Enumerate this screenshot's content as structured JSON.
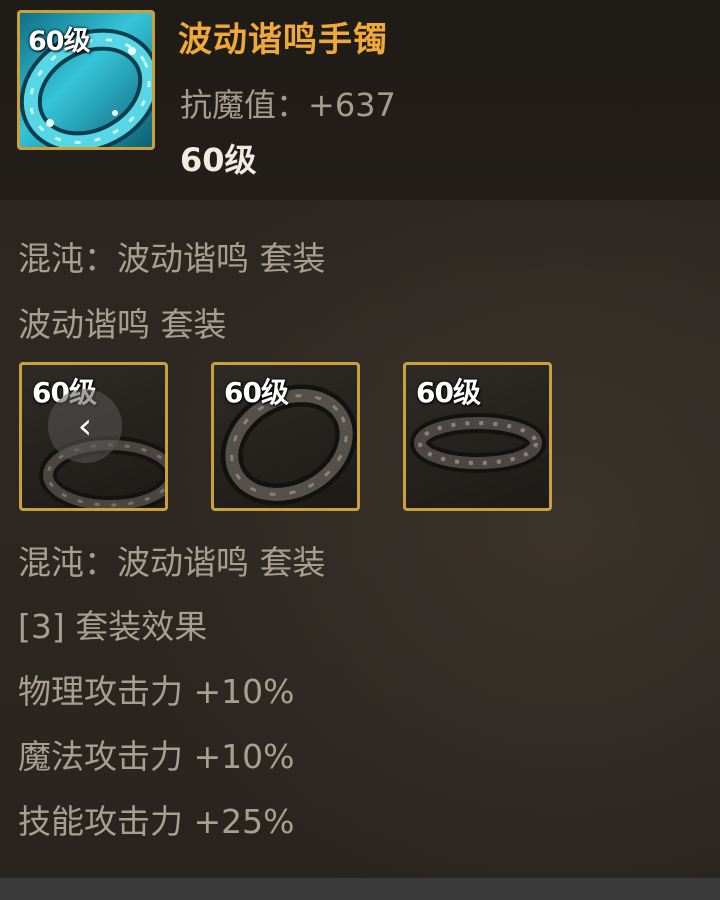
{
  "item": {
    "icon": "bracelet-icon",
    "level_tag": "60级",
    "name": "波动谐鸣手镯",
    "stat": "抗魔值：+637",
    "level": "60级"
  },
  "set": {
    "set_line_1": "混沌：波动谐鸣 套装",
    "set_line_2": "波动谐鸣 套装",
    "pieces": [
      {
        "level_tag": "60级",
        "icon": "ring-icon"
      },
      {
        "level_tag": "60级",
        "icon": "bracelet-icon"
      },
      {
        "level_tag": "60级",
        "icon": "necklace-icon"
      }
    ],
    "set_line_3": "混沌：波动谐鸣 套装",
    "effect_header": "[3] 套装效果",
    "effects": [
      "物理攻击力 +10%",
      "魔法攻击力 +10%",
      "技能攻击力 +25%"
    ]
  },
  "nav": {
    "back_icon": "chevron-left-icon",
    "back_glyph": "‹"
  },
  "colors": {
    "name_orange": "#f0a938",
    "frame_gold": "#c9a03a",
    "text_gray": "#a7a092",
    "background": "#2b2621"
  }
}
